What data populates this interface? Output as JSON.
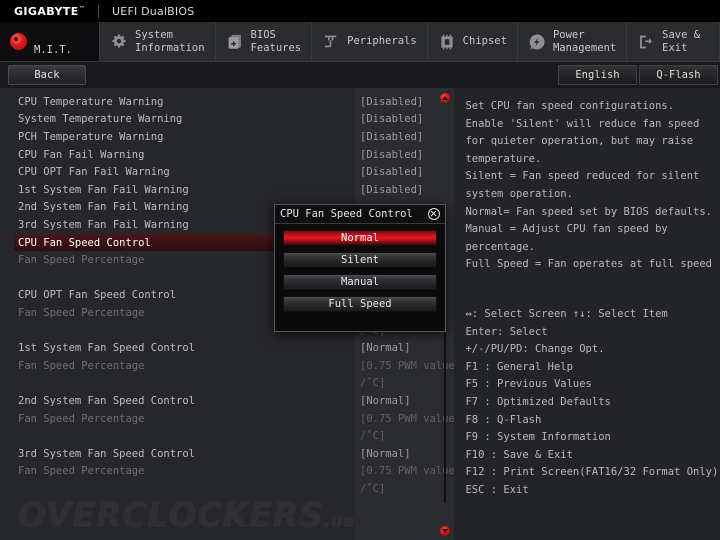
{
  "brand": {
    "logo": "GIGABYTE",
    "tm": "™",
    "subtitle": "UEFI DualBIOS"
  },
  "tabs": [
    {
      "label": "M.I.T.",
      "icon": "mit-dot-icon",
      "active": true
    },
    {
      "label": "System\nInformation",
      "icon": "gear-icon"
    },
    {
      "label": "BIOS\nFeatures",
      "icon": "document-plus-icon"
    },
    {
      "label": "Peripherals",
      "icon": "plug-icon"
    },
    {
      "label": "Chipset",
      "icon": "chip-icon"
    },
    {
      "label": "Power\nManagement",
      "icon": "lightning-icon"
    },
    {
      "label": "Save & Exit",
      "icon": "exit-arrow-icon"
    }
  ],
  "subbar": {
    "back_label": "Back",
    "language_label": "English",
    "qflash_label": "Q-Flash"
  },
  "settings": [
    {
      "name": "CPU Temperature Warning",
      "value": "[Disabled]"
    },
    {
      "name": "System Temperature Warning",
      "value": "[Disabled]"
    },
    {
      "name": "PCH Temperature Warning",
      "value": "[Disabled]"
    },
    {
      "name": "CPU Fan Fail Warning",
      "value": "[Disabled]"
    },
    {
      "name": "CPU OPT Fan Fail Warning",
      "value": "[Disabled]"
    },
    {
      "name": "1st System Fan Fail Warning",
      "value": "[Disabled]"
    },
    {
      "name": "2nd System Fan Fail Warning",
      "value": ""
    },
    {
      "name": "3rd System Fan Fail Warning",
      "value": ""
    },
    {
      "name": "CPU Fan Speed Control",
      "value": "",
      "selected": true
    },
    {
      "name": "Fan Speed Percentage",
      "value": "",
      "dim": true
    },
    {
      "name": "",
      "value": ""
    },
    {
      "name": "CPU OPT Fan Speed Control",
      "value": ""
    },
    {
      "name": "Fan Speed Percentage",
      "value": "",
      "dim": true
    },
    {
      "name": "",
      "value": "/˚C]",
      "dim": true
    },
    {
      "name": "1st System Fan Speed Control",
      "value": "[Normal]"
    },
    {
      "name": "Fan Speed Percentage",
      "value": "[0.75 PWM value",
      "dim": true
    },
    {
      "name": "",
      "value": "/˚C]",
      "dim": true
    },
    {
      "name": "2nd System Fan Speed Control",
      "value": "[Normal]"
    },
    {
      "name": "Fan Speed Percentage",
      "value": "[0.75 PWM value",
      "dim": true
    },
    {
      "name": "",
      "value": "/˚C]",
      "dim": true
    },
    {
      "name": "3rd System Fan Speed Control",
      "value": "[Normal]"
    },
    {
      "name": "Fan Speed Percentage",
      "value": "[0.75 PWM value",
      "dim": true
    },
    {
      "name": "",
      "value": "/˚C]",
      "dim": true
    }
  ],
  "help": [
    "Set CPU fan speed configurations.",
    "Enable 'Silent' will reduce fan speed",
    "for quieter operation, but may raise",
    "temperature.",
    "Silent = Fan speed reduced for silent",
    "system operation.",
    "Normal= Fan speed set by BIOS defaults.",
    "Manual = Adjust CPU fan speed by",
    "percentage.",
    "Full Speed = Fan operates at full speed"
  ],
  "keys": [
    "↔: Select Screen  ↑↓: Select Item",
    "Enter: Select",
    "+/-/PU/PD: Change Opt.",
    "F1  : General Help",
    "F5  : Previous Values",
    "F7  : Optimized Defaults",
    "F8  : Q-Flash",
    "F9  : System Information",
    "F10 : Save & Exit",
    "F12 : Print Screen(FAT16/32 Format Only)",
    "ESC : Exit"
  ],
  "modal": {
    "title": "CPU Fan Speed Control",
    "close_icon": "close-circle-icon",
    "options": [
      {
        "label": "Normal",
        "selected": true
      },
      {
        "label": "Silent",
        "selected": false
      },
      {
        "label": "Manual",
        "selected": false
      },
      {
        "label": "Full Speed",
        "selected": false
      }
    ]
  },
  "watermark": {
    "text": "OVERCLOCKERS",
    "suffix": ".ua"
  },
  "colors": {
    "accent_red": "#e01820",
    "selected_row": "#4a1618",
    "panel_bg": "#26272a"
  }
}
